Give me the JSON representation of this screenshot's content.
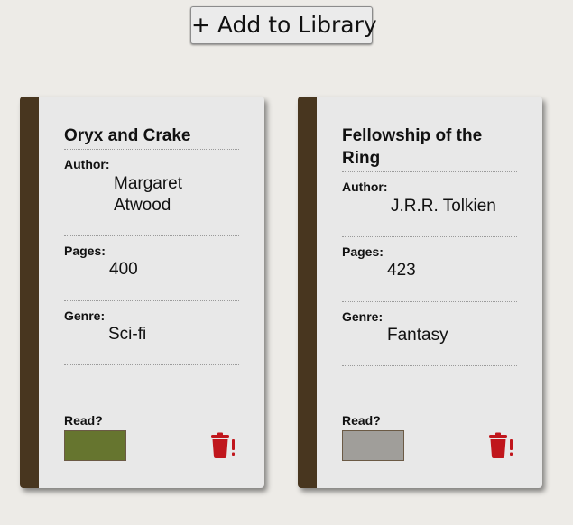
{
  "toolbar": {
    "add_label": "+ Add to Library"
  },
  "labels": {
    "author": "Author:",
    "pages": "Pages:",
    "genre": "Genre:",
    "read": "Read?"
  },
  "colors": {
    "spine": "#48361f",
    "read_on": "#66752f",
    "read_off": "#a09e9a",
    "delete": "#c0161c"
  },
  "books": [
    {
      "title": "Oryx and Crake",
      "author": "Margaret Atwood",
      "pages": "400",
      "genre": "Sci-fi",
      "read": true
    },
    {
      "title": "Fellowship of the Ring",
      "author": "J.R.R. Tolkien",
      "pages": "423",
      "genre": "Fantasy",
      "read": false
    }
  ]
}
